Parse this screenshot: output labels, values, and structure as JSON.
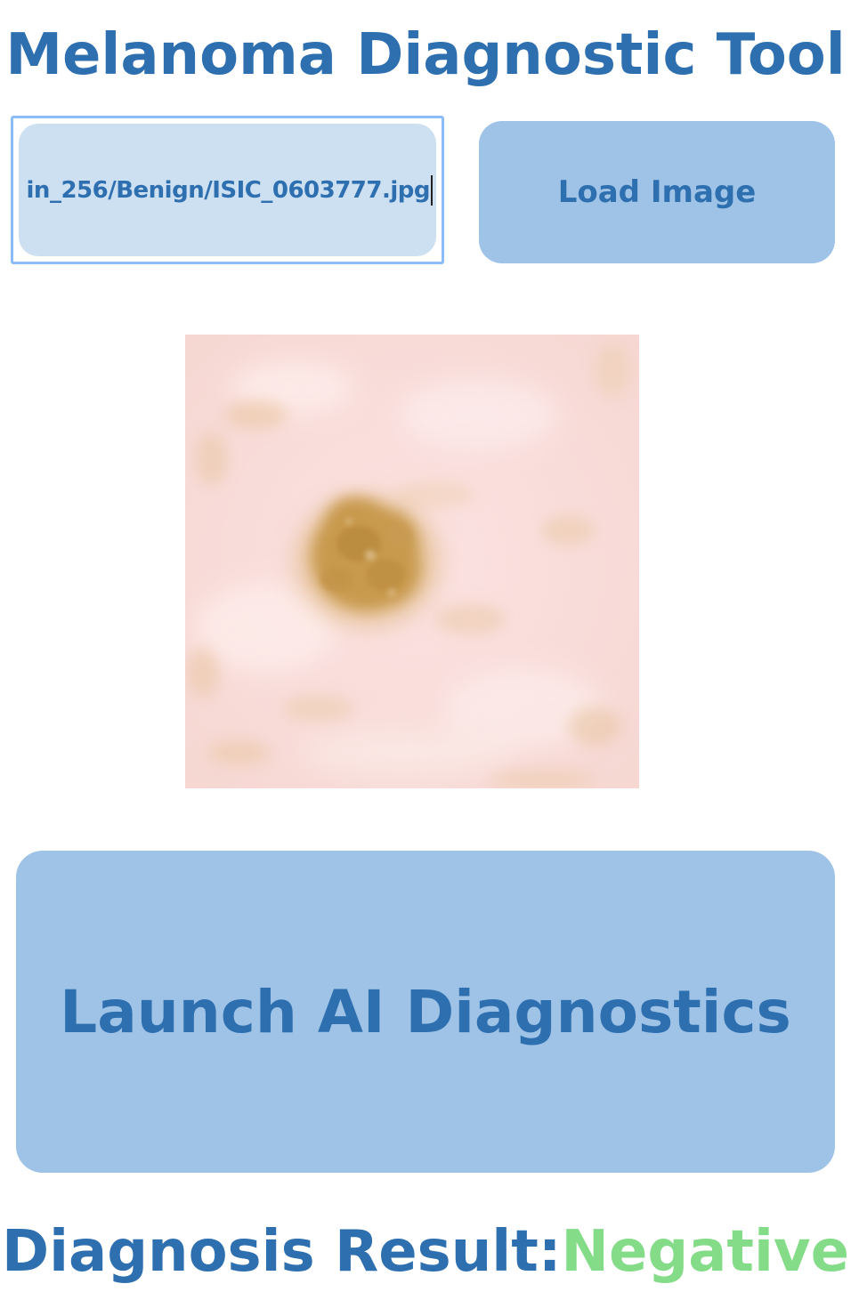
{
  "app": {
    "title": "Melanoma Diagnostic Tool"
  },
  "file_input": {
    "value": "in_256/Benign/ISIC_0603777.jpg"
  },
  "buttons": {
    "load_image": "Load Image",
    "launch": "Launch AI Diagnostics"
  },
  "result": {
    "label": "Diagnosis Result:",
    "value": "Negative"
  },
  "colors": {
    "accent_text": "#2e6fb0",
    "button_bg": "#9ec3e6",
    "input_bg": "#cde0f2",
    "focus_border": "#8cbcf5",
    "result_negative": "#84dc88"
  }
}
